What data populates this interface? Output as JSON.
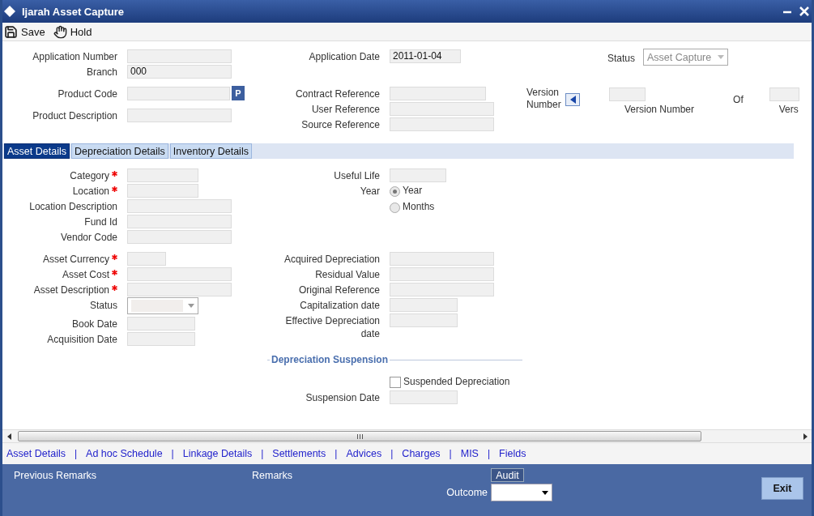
{
  "window": {
    "title": "Ijarah Asset Capture"
  },
  "toolbar": [
    {
      "kind": "save",
      "label": "Save"
    },
    {
      "kind": "hold",
      "label": "Hold"
    }
  ],
  "header": {
    "columns": [
      {
        "groups": [
          [
            {
              "label": "Application Number",
              "kind": "text"
            },
            {
              "label": "Branch",
              "kind": "text",
              "value": "000"
            }
          ],
          [
            {
              "label": "Product Code",
              "kind": "lookup",
              "button": "P"
            }
          ],
          [
            {
              "label": "Product Description",
              "kind": "text"
            }
          ]
        ]
      },
      {
        "groups": [
          [
            {
              "label": "Application Date",
              "kind": "code",
              "value": "2011-01-04"
            }
          ],
          [
            {
              "label": "Contract Reference",
              "kind": "reference"
            },
            {
              "label": "User Reference",
              "kind": "text"
            },
            {
              "label": "Source Reference",
              "kind": "text"
            }
          ]
        ]
      }
    ],
    "status": {
      "label": "Status",
      "value": "Asset Capture",
      "disabled": true
    },
    "version": {
      "label": "Version Number",
      "current_caption": "Version Number",
      "of": "Of",
      "total_caption": "Vers"
    }
  },
  "tabs": [
    {
      "label": "Asset Details",
      "selected": true
    },
    {
      "label": "Depreciation Details",
      "selected": false
    },
    {
      "label": "Inventory Details",
      "selected": false
    }
  ],
  "sections": [
    {
      "left": [
        {
          "label": "Category",
          "kind": "code",
          "required": true
        },
        {
          "label": "Location",
          "kind": "code",
          "required": true
        },
        {
          "label": "Location Description",
          "kind": "text",
          "required": false
        },
        {
          "label": "Fund Id",
          "kind": "text",
          "required": false
        },
        {
          "label": "Vendor Code",
          "kind": "text",
          "required": false
        }
      ],
      "right": [
        {
          "label": "Useful Life",
          "kind": "life",
          "required": false
        },
        {
          "label": "Year",
          "kind": "radio",
          "options": [
            {
              "label": "Year",
              "selected": true
            },
            {
              "label": "Months",
              "selected": false
            }
          ]
        }
      ]
    },
    {
      "left": [
        {
          "label": "Asset Currency",
          "kind": "currency",
          "required": true
        },
        {
          "label": "Asset Cost",
          "kind": "text",
          "required": true
        },
        {
          "label": "Asset Description",
          "kind": "text",
          "required": true
        },
        {
          "label": "Status",
          "kind": "select",
          "required": false
        },
        {
          "label": "Book Date",
          "kind": "date",
          "required": false
        },
        {
          "label": "Acquisition Date",
          "kind": "date",
          "required": false
        }
      ],
      "right": [
        {
          "label": "Acquired Depreciation",
          "kind": "text",
          "required": false
        },
        {
          "label": "Residual Value",
          "kind": "text",
          "required": false
        },
        {
          "label": "Original Reference",
          "kind": "text",
          "required": false
        },
        {
          "label": "Capitalization date",
          "kind": "date",
          "required": false
        },
        {
          "label": "Effective Depreciation date",
          "kind": "date",
          "required": false
        },
        {
          "label": "Depreciation Suspension",
          "kind": "heading"
        },
        {
          "label": "Suspended Depreciation",
          "kind": "checkbox",
          "checked": false
        },
        {
          "label": "Suspension Date",
          "kind": "date",
          "required": false
        }
      ]
    }
  ],
  "footer_links": [
    {
      "kind": "link",
      "label": "Asset Details"
    },
    {
      "kind": "separator",
      "label": "|"
    },
    {
      "kind": "link",
      "label": "Ad hoc Schedule"
    },
    {
      "kind": "separator",
      "label": "|"
    },
    {
      "kind": "link",
      "label": "Linkage Details"
    },
    {
      "kind": "separator",
      "label": "|"
    },
    {
      "kind": "link",
      "label": "Settlements"
    },
    {
      "kind": "separator",
      "label": "|"
    },
    {
      "kind": "link",
      "label": "Advices"
    },
    {
      "kind": "separator",
      "label": "|"
    },
    {
      "kind": "link",
      "label": "Charges"
    },
    {
      "kind": "separator",
      "label": "|"
    },
    {
      "kind": "link",
      "label": "MIS"
    },
    {
      "kind": "separator",
      "label": "|"
    },
    {
      "kind": "link",
      "label": "Fields"
    }
  ],
  "footer": {
    "previous_remarks": "Previous Remarks",
    "remarks": "Remarks",
    "audit": "Audit",
    "outcome": "Outcome",
    "exit": "Exit"
  }
}
